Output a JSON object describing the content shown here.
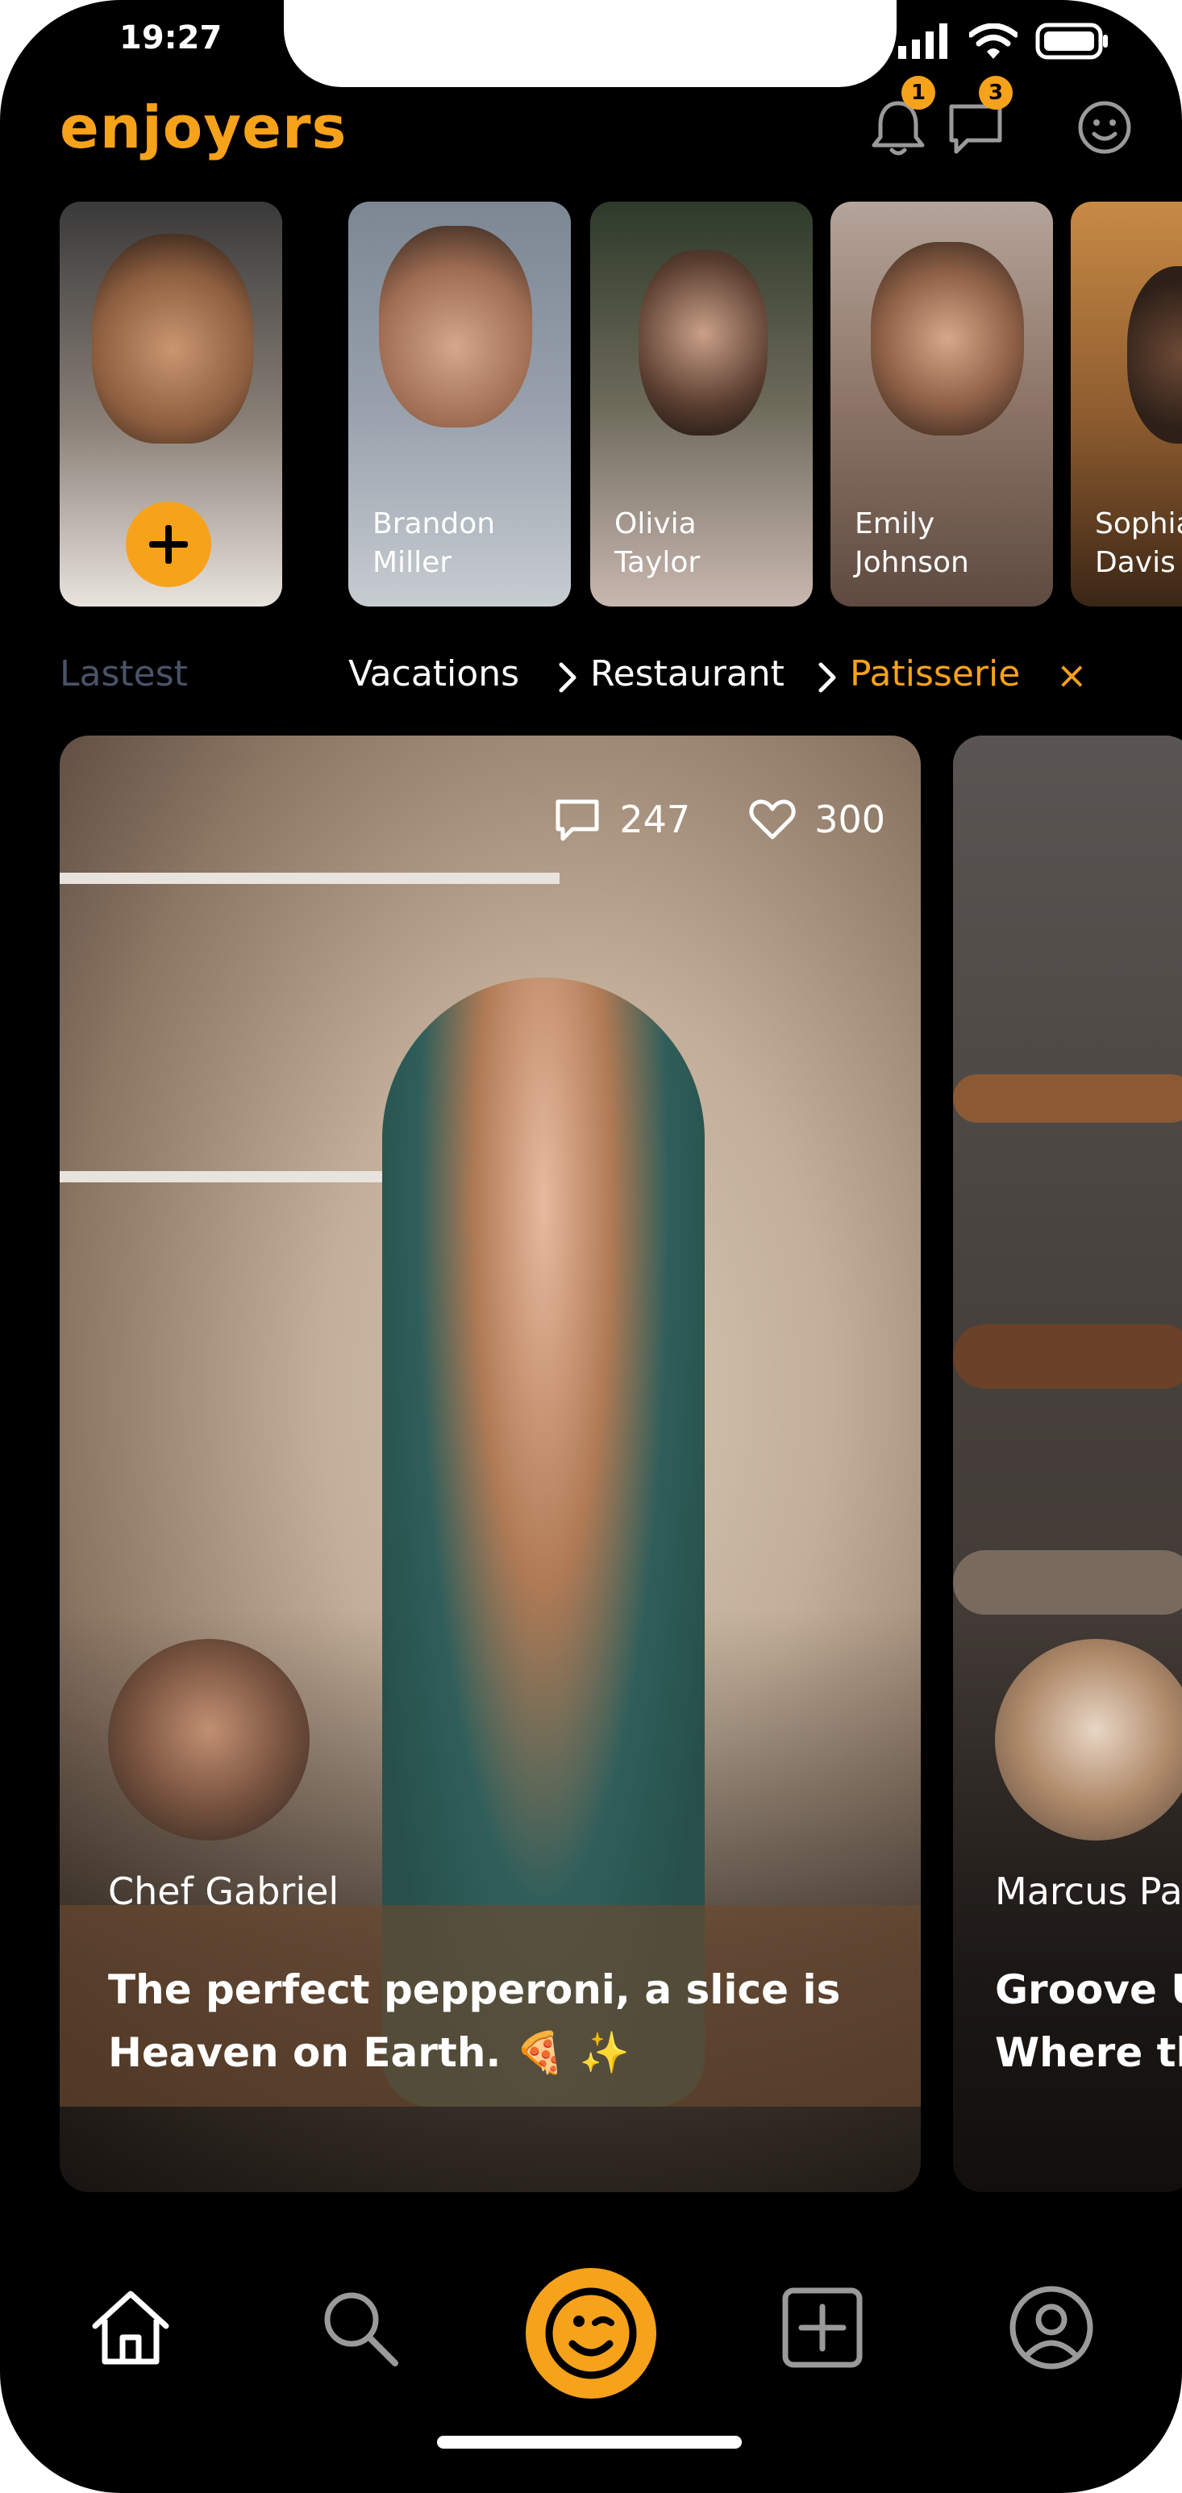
{
  "status": {
    "time": "19:27"
  },
  "header": {
    "logo": "enjoyers",
    "notifications_badge": "1",
    "messages_badge": "3"
  },
  "stories": [
    {
      "type": "add",
      "name": ""
    },
    {
      "first": "Brandon",
      "last": "Miller"
    },
    {
      "first": "Olivia",
      "last": "Taylor"
    },
    {
      "first": "Emily",
      "last": "Johnson"
    },
    {
      "first": "Sophia",
      "last": "Davis"
    }
  ],
  "filters": {
    "latest": "Lastest",
    "crumbs": [
      "Vacations",
      "Restaurant",
      "Patisserie"
    ],
    "clear": "×"
  },
  "posts": [
    {
      "comments": "247",
      "likes": "300",
      "author": "Chef Gabriel",
      "caption_line1": "The perfect pepperoni, a slice is",
      "caption_line2": "Heaven on Earth. 🍕 ✨"
    },
    {
      "author": "Marcus Pa",
      "caption_line1": "Groove U",
      "caption_line2": "Where th"
    }
  ],
  "nav": {
    "items": [
      "home-icon",
      "search-icon",
      "wink-icon",
      "add-icon",
      "profile-icon"
    ],
    "active": "home-icon"
  },
  "colors": {
    "accent": "#f7a21b",
    "background": "#000000",
    "muted": "#4a5368"
  }
}
